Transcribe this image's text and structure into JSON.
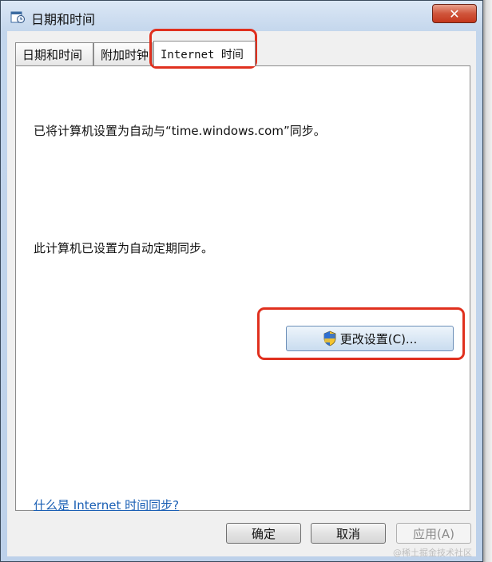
{
  "window": {
    "title": "日期和时间",
    "close_label": "✕"
  },
  "tabs": [
    {
      "label": "日期和时间",
      "active": false
    },
    {
      "label": "附加时钟",
      "active": false
    },
    {
      "label": "Internet 时间",
      "active": true
    }
  ],
  "panel": {
    "sync_text": "已将计算机设置为自动与“time.windows.com”同步。",
    "auto_text": "此计算机已设置为自动定期同步。",
    "change_button": "更改设置(C)...",
    "help_link": "什么是 Internet 时间同步?"
  },
  "footer": {
    "ok": "确定",
    "cancel": "取消",
    "apply": "应用(A)"
  },
  "watermark": "@稀土掘金技术社区",
  "colors": {
    "highlight": "#e0301e",
    "link": "#1a5fb4"
  }
}
